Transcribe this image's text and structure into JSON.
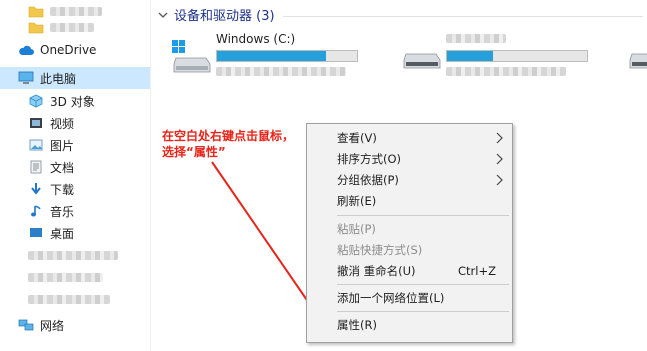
{
  "nav": {
    "onedrive": "OneDrive",
    "this_pc": "此电脑",
    "objects3d": "3D 对象",
    "videos": "视频",
    "pictures": "图片",
    "documents": "文档",
    "downloads": "下载",
    "music": "音乐",
    "desktop": "桌面",
    "network": "网络"
  },
  "content": {
    "group_title": "设备和驱动器 (3)",
    "drives": [
      {
        "name": "Windows (C:)",
        "usage_fraction": 0.78
      },
      {
        "name": "",
        "usage_fraction": 0.33
      }
    ]
  },
  "context_menu": {
    "items": [
      {
        "label": "查看(V)",
        "submenu": true
      },
      {
        "label": "排序方式(O)",
        "submenu": true
      },
      {
        "label": "分组依据(P)",
        "submenu": true
      },
      {
        "label": "刷新(E)"
      },
      {
        "label": "粘贴(P)",
        "disabled": true
      },
      {
        "label": "粘贴快捷方式(S)",
        "disabled": true
      },
      {
        "label": "撤消 重命名(U)",
        "shortcut": "Ctrl+Z"
      },
      {
        "label": "添加一个网络位置(L)"
      },
      {
        "label": "属性(R)"
      }
    ]
  },
  "annotation": {
    "line1": "在空白处右键点击鼠标，",
    "line2": "选择“属性”"
  },
  "colors": {
    "selection": "#cce8ff",
    "progress": "#26a0da",
    "annotation": "#e8241a",
    "group_title": "#1e3287"
  }
}
